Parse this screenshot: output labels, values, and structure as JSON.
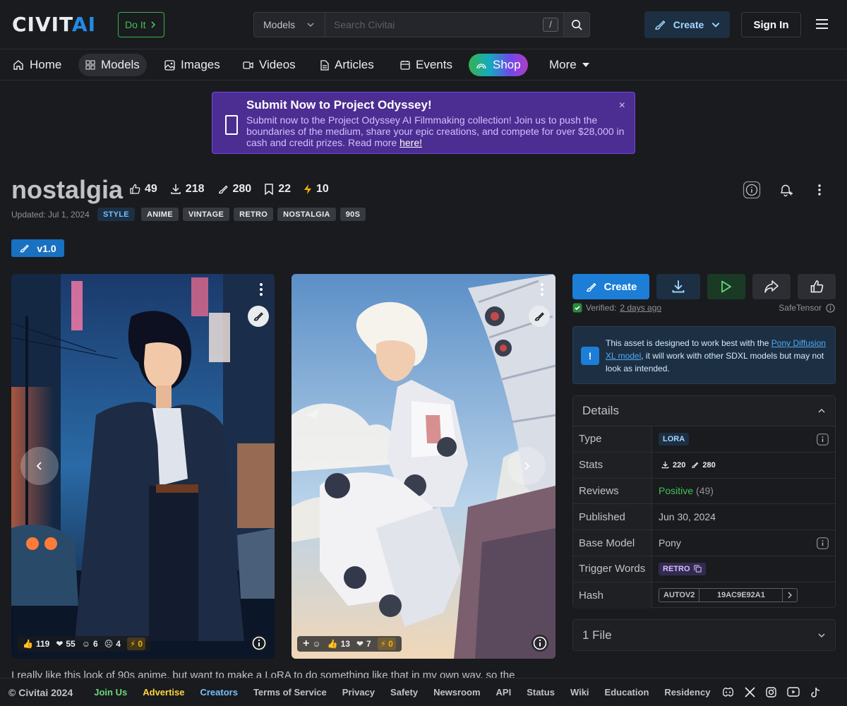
{
  "header": {
    "logo_part1": "CIVIT",
    "logo_part2": "AI",
    "doit_label": "Do It",
    "search_scope": "Models",
    "search_placeholder": "Search Civitai",
    "search_shortcut": "/",
    "create_label": "Create",
    "signin_label": "Sign In"
  },
  "nav": {
    "items": [
      {
        "label": "Home",
        "icon": "home-icon"
      },
      {
        "label": "Models",
        "icon": "grid-icon"
      },
      {
        "label": "Images",
        "icon": "image-icon"
      },
      {
        "label": "Videos",
        "icon": "video-icon"
      },
      {
        "label": "Articles",
        "icon": "file-icon"
      },
      {
        "label": "Events",
        "icon": "calendar-icon"
      },
      {
        "label": "Shop",
        "icon": "rainbow-icon"
      },
      {
        "label": "More",
        "icon": "caret-down-icon"
      }
    ]
  },
  "banner": {
    "title": "Submit Now to Project Odyssey!",
    "body": "Submit now to the Project Odyssey AI Filmmaking collection! Join us to push the boundaries of the medium, share your epic creations, and compete for over $28,000 in cash and credit prizes. Read more ",
    "link": "here!",
    "close": "×"
  },
  "model": {
    "title": "nostalgia",
    "stats": {
      "likes": "49",
      "downloads": "218",
      "generations": "280",
      "bookmarks": "22",
      "buzz": "10"
    },
    "updated": "Updated: Jul 1, 2024",
    "style_tag": "STYLE",
    "tags": [
      "ANIME",
      "VINTAGE",
      "RETRO",
      "NOSTALGIA",
      "90S"
    ],
    "version": "v1.0"
  },
  "cards": [
    {
      "reacts": {
        "like": "119",
        "heart": "55",
        "laugh": "6",
        "cry": "4",
        "buzz": "0"
      }
    },
    {
      "reacts": {
        "like": "13",
        "heart": "7",
        "buzz": "0"
      }
    }
  ],
  "panel": {
    "create_label": "Create",
    "verified_prefix": "Verified:",
    "verified_when": "2 days ago",
    "safetensor": "SafeTensor",
    "notice_pre": "This asset is designed to work best with the ",
    "notice_link": "Pony Diffusion XL model",
    "notice_post": ", it will work with other SDXL models but may not look as intended.",
    "details_title": "Details",
    "details": {
      "type_label": "Type",
      "type_value": "LORA",
      "stats_label": "Stats",
      "stats_downloads": "220",
      "stats_generations": "280",
      "reviews_label": "Reviews",
      "reviews_value": "Positive",
      "reviews_count": "(49)",
      "published_label": "Published",
      "published_value": "Jun 30, 2024",
      "base_label": "Base Model",
      "base_value": "Pony",
      "trigger_label": "Trigger Words",
      "trigger_value": "RETRO",
      "hash_label": "Hash",
      "hash_type": "AUTOV2",
      "hash_value": "19AC9E92A1"
    },
    "files_label": "1 File"
  },
  "description": "I really like this look of 90s anime, but want to make a LoRA to do something like that in my own way, so the",
  "footer": {
    "copyright": "© Civitai 2024",
    "links": [
      "Join Us",
      "Advertise",
      "Creators",
      "Terms of Service",
      "Privacy",
      "Safety",
      "Newsroom",
      "API",
      "Status",
      "Wiki",
      "Education",
      "Residency"
    ]
  },
  "colors": {
    "accent": "#228be6",
    "background": "#1a1b1e",
    "success": "#40c057",
    "buzz": "#fab005"
  }
}
